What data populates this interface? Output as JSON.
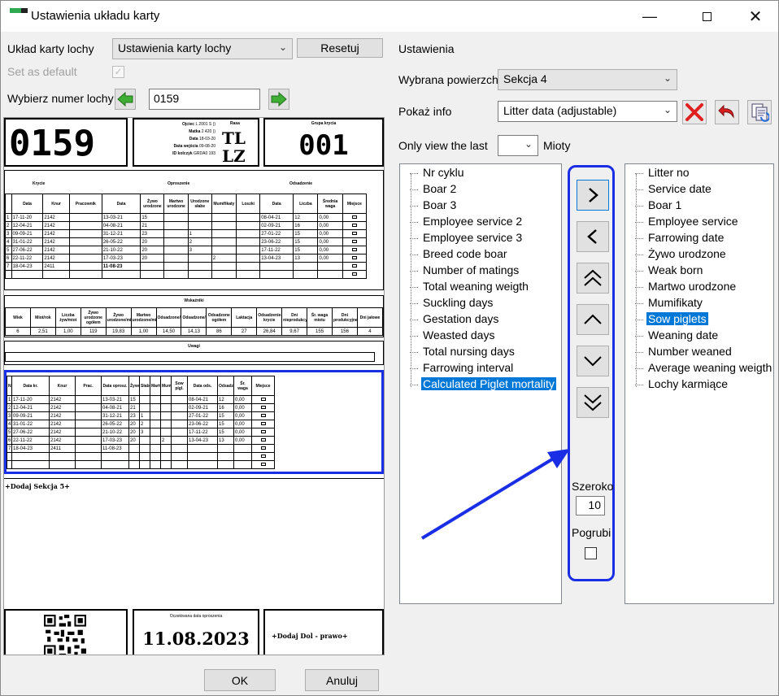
{
  "window": {
    "title": "Ustawienia układu karty"
  },
  "left": {
    "layout_label": "Układ karty lochy",
    "layout_value": "Ustawienia karty lochy",
    "reset_label": "Resetuj",
    "default_label": "Set as default",
    "select_sow_label": "Wybierz numer lochy",
    "sow_number": "0159"
  },
  "preview": {
    "sow_big": "0159",
    "father_label": "Ojciec",
    "father_value": "L 2001 S ()",
    "mother_label": "Matka",
    "mother_value": "2 420 ()",
    "date_label": "Data",
    "date_value": "18-03-20",
    "entry_date_label": "Data wejścia",
    "entry_date_value": "09-08-20",
    "id_label": "ID kolczyk",
    "id_value": "GRDA0 193",
    "breed_label": "Rasa",
    "breed_value_1": "TL",
    "breed_value_2": "LZ",
    "group_label": "Grupa krycia",
    "group_value": "001",
    "sec_mating": "Krycie",
    "sec_farrowing": "Oproszenie",
    "sec_weaning": "Odsadzenie",
    "h_date": "Data",
    "h_boar": "Knur",
    "h_worker": "Pracownik",
    "h_fdate": "Data",
    "h_live": "Żywo urodzone",
    "h_dead": "Martwo urodzone",
    "h_weak": "Urodzone słabe",
    "h_mumm": "Mumifikaty",
    "h_nurse": "Loszki",
    "h_wdate": "Data",
    "h_count": "Liczba",
    "h_avg": "Średnia waga",
    "h_place": "Miejsce",
    "rows": [
      {
        "n": "1",
        "d": "17-11-20",
        "k": "2142",
        "fd": "13-03-21",
        "l": "15",
        "wd": "08-04-21",
        "c": "12",
        "a": "0,00"
      },
      {
        "n": "2",
        "d": "12-04-21",
        "k": "2142",
        "fd": "04-08-21",
        "l": "21",
        "wd": "02-09-21",
        "c": "16",
        "a": "0,00"
      },
      {
        "n": "3",
        "d": "09-09-21",
        "k": "2142",
        "fd": "31-12-21",
        "l": "23",
        "m": "1",
        "wd": "27-01-22",
        "c": "15",
        "a": "0,00"
      },
      {
        "n": "4",
        "d": "31-01-22",
        "k": "2142",
        "fd": "26-05-22",
        "l": "20",
        "m": "2",
        "wd": "23-06-22",
        "c": "15",
        "a": "0,00"
      },
      {
        "n": "5",
        "d": "27-06-22",
        "k": "2142",
        "fd": "21-10-22",
        "l": "20",
        "m": "3",
        "wd": "17-11-22",
        "c": "15",
        "a": "0,00"
      },
      {
        "n": "6",
        "d": "22-11-22",
        "k": "2142",
        "fd": "17-03-23",
        "l": "20",
        "mu": "2",
        "wd": "13-04-23",
        "c": "13",
        "a": "0,00"
      },
      {
        "n": "7",
        "d": "18-04-23",
        "k": "2411",
        "fd": "11-08-23",
        "l": "",
        "wd": "",
        "c": "",
        "a": ""
      }
    ],
    "indicators_title": "Wskaźniki",
    "ind_headers": [
      "Wiek",
      "Miot/rok",
      "Liczba żyw/miot",
      "Żywo urodzone ogółem",
      "Żywo urodzone/miot",
      "Martwo urodzone/miot",
      "Odsadzone/miot",
      "Odsadzone/rok",
      "Odsadzone ogółem",
      "Laktacja",
      "Odsadzenie-krycie",
      "Dni nieprodukcyjne",
      "Śr. waga miotu",
      "Dni produkcyjne",
      "Dni jałowe"
    ],
    "ind_values": [
      "6",
      "2,51",
      "1,00",
      "119",
      "19,83",
      "1,00",
      "14,50",
      "14,13",
      "86",
      "27",
      "26,84",
      "9,67",
      "155",
      "156",
      "4"
    ],
    "notes_title": "Uwagi",
    "s2_headers": [
      "Nr",
      "Data kr.",
      "Knur",
      "Prac.",
      "Data oprosz.",
      "Żywo",
      "Słabe",
      "Martw.",
      "Mum.",
      "Sow pigl.",
      "Data ods.",
      "Odsadz.",
      "Śr. waga",
      "Miejsce"
    ],
    "add_section": "+Dodaj Sekcja 5+",
    "due_label": "Oczekiwana data oproszenia",
    "due_date": "11.08.2023",
    "add_bottom_right": "+Dodaj Dol - prawo+"
  },
  "right": {
    "settings_label": "Ustawienia",
    "surface_label": "Wybrana powierzchnia",
    "surface_value": "Sekcja 4",
    "show_info_label": "Pokaż info",
    "show_info_value": "Litter data (adjustable)",
    "last_label": "Only view the last",
    "litters_label": "Mioty",
    "available": [
      "Nr cyklu",
      "Boar 2",
      "Boar 3",
      "Employee service 2",
      "Employee service 3",
      "Breed code boar",
      "Number of matings",
      "Total weaning weigth",
      "Suckling days",
      "Gestation days",
      "Weasted days",
      "Total nursing days",
      "Farrowing interval",
      "Calculated Piglet mortality"
    ],
    "selected": [
      "Litter no",
      "Service date",
      "Boar 1",
      "Employee service",
      "Farrowing date",
      "Żywo urodzone",
      "Weak born",
      "Martwo urodzone",
      "Mumifikaty",
      "Sow piglets",
      "Weaning date",
      "Number weaned",
      "Average weaning weigth",
      "Lochy karmiące"
    ],
    "width_label": "Szeroko",
    "width_value": "10",
    "bold_label": "Pogrubi"
  },
  "footer": {
    "ok": "OK",
    "cancel": "Anuluj"
  },
  "colors": {
    "highlight": "#1a2ee6",
    "selection": "#0078d7"
  }
}
